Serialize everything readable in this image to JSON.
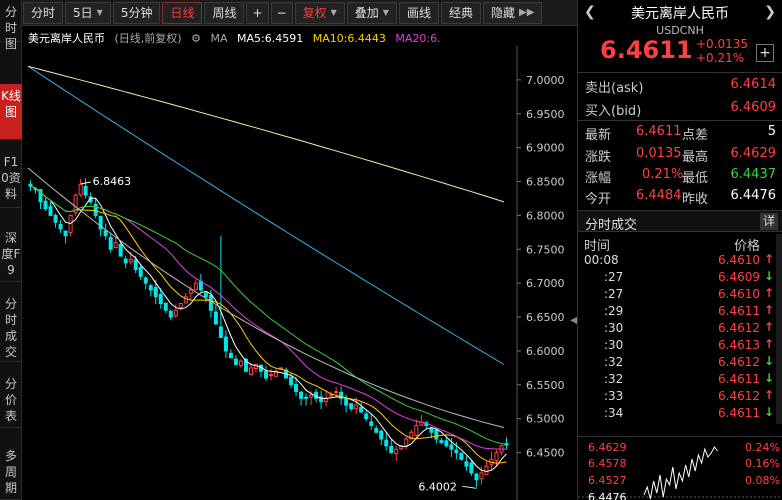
{
  "left_nav": [
    {
      "label": "分时图",
      "active": false
    },
    {
      "label": "K线图",
      "active": true
    },
    {
      "label": "F10资料",
      "active": false
    },
    {
      "label": "深度F9",
      "active": false
    },
    {
      "label": "分时成交",
      "active": false
    },
    {
      "label": "分价表",
      "active": false
    },
    {
      "label": "多周期",
      "active": false
    }
  ],
  "toolbar": {
    "fenshi": "分时",
    "five_day": "5日",
    "five_min": "5分钟",
    "day": "日线",
    "week": "周线",
    "plus": "+",
    "minus": "−",
    "fuquan": "复权",
    "overlay": "叠加",
    "draw": "画线",
    "classic": "经典",
    "hide": "隐藏"
  },
  "legend": {
    "name": "美元离岸人民币",
    "mode": "(日线,前复权)",
    "ma_label": "MA",
    "ma5": "MA5:6.4591",
    "ma10": "MA10:6.4443",
    "ma20": "MA20:6."
  },
  "colors": {
    "up": "#ff4040",
    "down": "#00e5e5",
    "ma5": "#ffffff",
    "ma10": "#ffd200",
    "ma20": "#e040e0",
    "ma_green": "#3ccc3c",
    "ma_gray": "#bbbbbb",
    "ma_blue": "#36b0e8",
    "ma_yellow": "#f0f0a0"
  },
  "chart_data": {
    "type": "candlestick",
    "y_ticks": [
      "7.0000",
      "6.9500",
      "6.9000",
      "6.8500",
      "6.8000",
      "6.7500",
      "6.7000",
      "6.6500",
      "6.6000",
      "6.5500",
      "6.5000",
      "6.4500"
    ],
    "ylim": [
      6.38,
      7.05
    ],
    "annotations": [
      {
        "text": "6.8463",
        "value": 6.8463
      },
      {
        "text": "6.4002",
        "value": 6.4002
      }
    ],
    "close_series": [
      6.843,
      6.838,
      6.82,
      6.81,
      6.8,
      6.79,
      6.78,
      6.77,
      6.8,
      6.83,
      6.846,
      6.83,
      6.82,
      6.8,
      6.78,
      6.77,
      6.75,
      6.76,
      6.74,
      6.73,
      6.735,
      6.72,
      6.71,
      6.7,
      6.69,
      6.68,
      6.67,
      6.66,
      6.65,
      6.66,
      6.67,
      6.68,
      6.69,
      6.7,
      6.69,
      6.68,
      6.66,
      6.64,
      6.62,
      6.6,
      6.59,
      6.58,
      6.585,
      6.57,
      6.575,
      6.58,
      6.57,
      6.56,
      6.565,
      6.57,
      6.575,
      6.56,
      6.55,
      6.54,
      6.53,
      6.53,
      6.535,
      6.53,
      6.525,
      6.53,
      6.535,
      6.54,
      6.53,
      6.52,
      6.515,
      6.52,
      6.51,
      6.5,
      6.49,
      6.48,
      6.47,
      6.46,
      6.45,
      6.455,
      6.46,
      6.47,
      6.48,
      6.49,
      6.495,
      6.49,
      6.48,
      6.47,
      6.465,
      6.46,
      6.455,
      6.45,
      6.44,
      6.43,
      6.42,
      6.41,
      6.42,
      6.43,
      6.44,
      6.45,
      6.46,
      6.461
    ]
  },
  "quote": {
    "title": "美元离岸人民币",
    "code": "USDCNH",
    "price": "6.4611",
    "change": "+0.0135",
    "change_pct": "+0.21%",
    "ask_label": "卖出(ask)",
    "ask": "6.4614",
    "bid_label": "买入(bid)",
    "bid": "6.4609",
    "latest_label": "最新",
    "latest": "6.4611",
    "spread_label": "点差",
    "spread": "5",
    "zhangdie_label": "涨跌",
    "zhangdie": "0.0135",
    "high_label": "最高",
    "high": "6.4629",
    "zhangfu_label": "涨幅",
    "zhangfu": "0.21%",
    "low_label": "最低",
    "low": "6.4437",
    "open_label": "今开",
    "open": "6.4484",
    "prev_label": "昨收",
    "prev": "6.4476"
  },
  "trades": {
    "title": "分时成交",
    "detail": "详",
    "col_time": "时间",
    "col_price": "价格",
    "rows": [
      {
        "time": "00:08",
        "price": "6.4610",
        "dir": "up"
      },
      {
        "time": ":27",
        "price": "6.4609",
        "dir": "down"
      },
      {
        "time": ":27",
        "price": "6.4610",
        "dir": "up"
      },
      {
        "time": ":29",
        "price": "6.4611",
        "dir": "up"
      },
      {
        "time": ":30",
        "price": "6.4612",
        "dir": "up"
      },
      {
        "time": ":30",
        "price": "6.4613",
        "dir": "up"
      },
      {
        "time": ":32",
        "price": "6.4612",
        "dir": "down"
      },
      {
        "time": ":32",
        "price": "6.4611",
        "dir": "down"
      },
      {
        "time": ":33",
        "price": "6.4612",
        "dir": "up"
      },
      {
        "time": ":34",
        "price": "6.4611",
        "dir": "down"
      }
    ]
  },
  "mini": {
    "p1": "6.4629",
    "p2": "6.4578",
    "p3": "6.4527",
    "p4": "6.4476",
    "pct1": "0.24%",
    "pct2": "0.16%",
    "pct3": "0.08%"
  }
}
